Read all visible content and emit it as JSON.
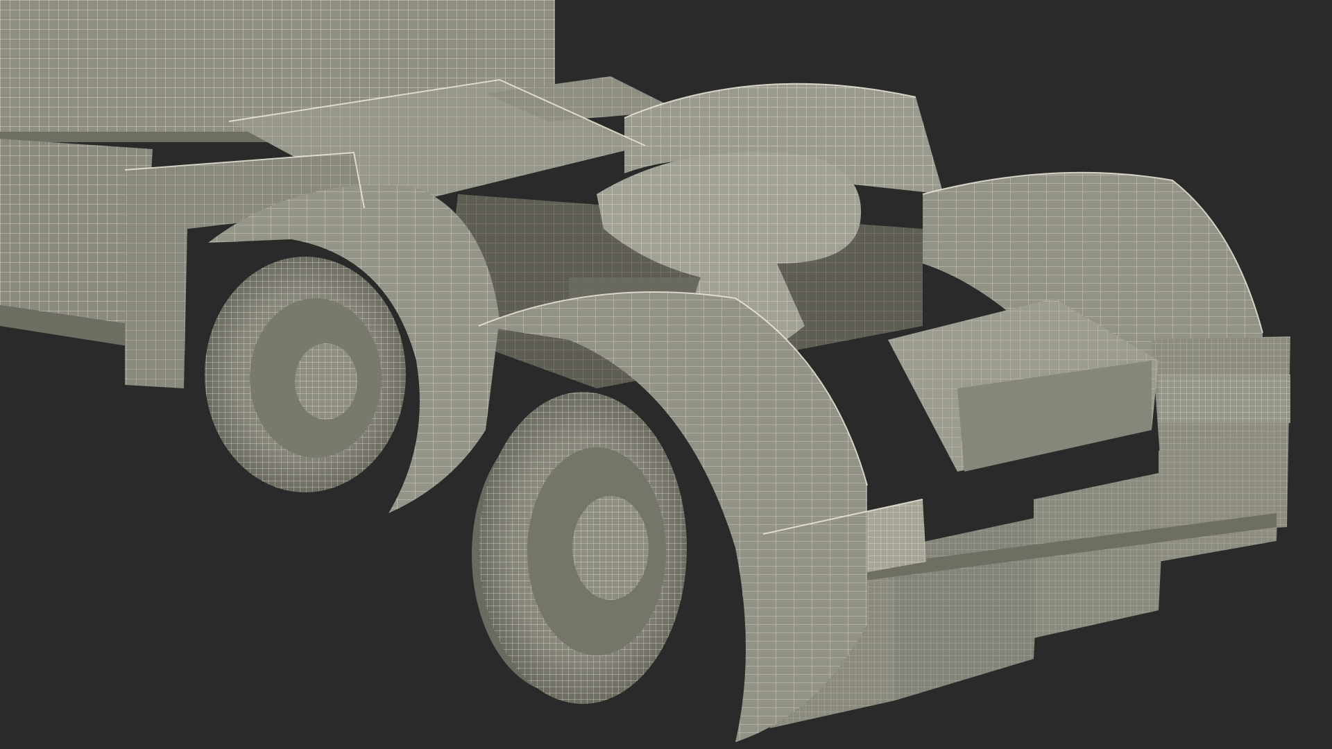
{
  "scene": {
    "subject": "wireframe-render",
    "colors": {
      "background": "#2a2a2a",
      "surface": "#8d8c80",
      "surface_light": "#a3a296",
      "surface_dark": "#6e6d62",
      "wire": "#e9e6d6",
      "shadow": "#55544b"
    }
  }
}
